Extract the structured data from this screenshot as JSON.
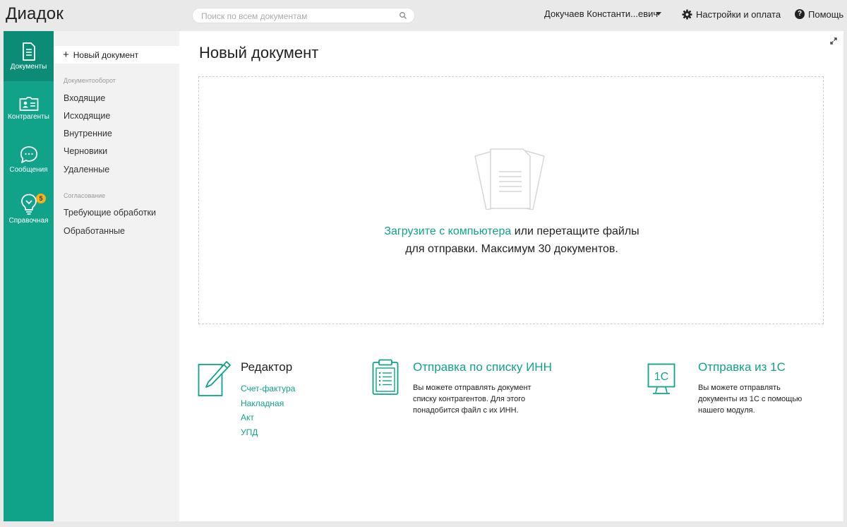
{
  "app": {
    "title": "Диадок"
  },
  "search": {
    "placeholder": "Поиск по всем документам"
  },
  "header": {
    "user_name": "Докучаев Константи...евич",
    "settings_label": "Настройки и оплата",
    "help_label": "Помощь"
  },
  "rail": {
    "items": [
      {
        "label": "Документы",
        "icon": "document-icon"
      },
      {
        "label": "Контрагенты",
        "icon": "contact-card-icon"
      },
      {
        "label": "Сообщения",
        "icon": "chat-bubble-icon"
      },
      {
        "label": "Справочная",
        "icon": "lightbulb-icon",
        "badge": "5"
      }
    ]
  },
  "subnav": {
    "new_document": "Новый документ",
    "section_docflow": "Документооборот",
    "docflow_items": [
      "Входящие",
      "Исходящие",
      "Внутренние",
      "Черновики",
      "Удаленные"
    ],
    "section_approval": "Согласование",
    "approval_items": [
      "Требующие обработки",
      "Обработанные"
    ]
  },
  "main": {
    "title": "Новый документ",
    "dropzone": {
      "upload_link": "Загрузите с компьютера",
      "text_rest": " или перетащите файлы",
      "text_line2": "для отправки. Максимум 30 документов."
    },
    "features": {
      "editor": {
        "title": "Редактор",
        "links": [
          "Счет-фактура",
          "Накладная",
          "Акт",
          "УПД"
        ]
      },
      "inn": {
        "title": "Отправка по списку ИНН",
        "desc_lines": [
          "Вы можете отправлять документ",
          "списку контрагентов. Для этого",
          "понадобится файл с их ИНН."
        ]
      },
      "onec": {
        "title": "Отправка из 1С",
        "icon_text": "1С",
        "desc_lines": [
          "Вы можете отправлять",
          "документы из 1С с помощью",
          "нашего модуля."
        ]
      }
    }
  },
  "colors": {
    "accent": "#10a38a",
    "accent_dark": "#0c8c76",
    "badge": "#f2b21c"
  }
}
